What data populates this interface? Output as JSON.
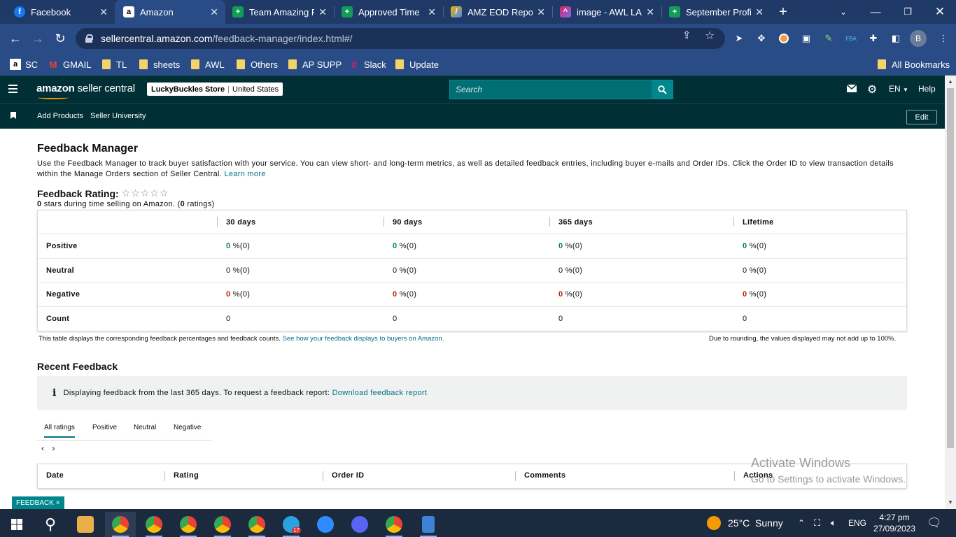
{
  "browser": {
    "tabs": [
      {
        "title": "Facebook",
        "icon": "facebook-icon",
        "color": "#1877f2",
        "glyph": "f"
      },
      {
        "title": "Amazon",
        "icon": "amazon-icon",
        "color": "#000000",
        "glyph": "a"
      },
      {
        "title": "Team Amazing P",
        "icon": "sheets-icon",
        "color": "#0f9d58",
        "glyph": "+"
      },
      {
        "title": "Approved Time",
        "icon": "sheets-icon",
        "color": "#0f9d58",
        "glyph": "+"
      },
      {
        "title": "AMZ EOD Repor",
        "icon": "slides-icon",
        "color": "#f4b400",
        "glyph": "/"
      },
      {
        "title": "image - AWL LA",
        "icon": "clickup-icon",
        "color": "#e0245e",
        "glyph": "^"
      },
      {
        "title": "September Profi",
        "icon": "sheets-icon",
        "color": "#0f9d58",
        "glyph": "+"
      }
    ],
    "url_domain": "sellercentral.amazon.com",
    "url_path": "/feedback-manager/index.html#/",
    "profile_initial": "B",
    "bookmarks": [
      {
        "label": "SC",
        "icon": "amazon-icon"
      },
      {
        "label": "GMAIL",
        "icon": "gmail-icon"
      },
      {
        "label": "TL",
        "icon": "folder-icon"
      },
      {
        "label": "sheets",
        "icon": "folder-icon"
      },
      {
        "label": "AWL",
        "icon": "folder-icon"
      },
      {
        "label": "Others",
        "icon": "folder-icon"
      },
      {
        "label": "AP SUPP",
        "icon": "folder-icon"
      },
      {
        "label": "Slack",
        "icon": "slack-icon"
      },
      {
        "label": "Update",
        "icon": "folder-icon"
      }
    ],
    "all_bookmarks": "All Bookmarks"
  },
  "header": {
    "logo_brand": "amazon",
    "logo_product": "seller central",
    "store_name": "LuckyBuckles Store",
    "marketplace": "United States",
    "search_placeholder": "Search",
    "language": "EN",
    "help": "Help"
  },
  "subnav": {
    "links": [
      "Add Products",
      "Seller University"
    ],
    "edit": "Edit"
  },
  "page": {
    "title": "Feedback Manager",
    "intro": "Use the Feedback Manager to track buyer satisfaction with your service. You can view short- and long-term metrics, as well as detailed feedback entries, including buyer e-mails and Order IDs. Click the Order ID to view transaction details within the Manage Orders section of Seller Central.",
    "learn_more": "Learn more",
    "rating_label": "Feedback Rating:",
    "stars": "☆☆☆☆☆",
    "rating_value": "0",
    "rating_text": "stars during time selling on Amazon. (",
    "rating_count": "0",
    "rating_count_suffix": "ratings)",
    "metrics": {
      "columns": [
        "30 days",
        "90 days",
        "365 days",
        "Lifetime"
      ],
      "rows": [
        {
          "label": "Positive",
          "values": [
            "0",
            "0",
            "0",
            "0"
          ],
          "suffix": "%(0)",
          "kind": "pos"
        },
        {
          "label": "Neutral",
          "values": [
            "0",
            "0",
            "0",
            "0"
          ],
          "suffix": "%(0)",
          "kind": "neu"
        },
        {
          "label": "Negative",
          "values": [
            "0",
            "0",
            "0",
            "0"
          ],
          "suffix": "%(0)",
          "kind": "neg"
        },
        {
          "label": "Count",
          "values": [
            "0",
            "0",
            "0",
            "0"
          ],
          "suffix": "",
          "kind": "count"
        }
      ]
    },
    "note_left": "This table displays the corresponding feedback percentages and feedback counts.",
    "note_left_link": "See how your feedback displays to buyers on Amazon.",
    "note_right": "Due to rounding, the values displayed may not add up to 100%.",
    "recent_title": "Recent Feedback",
    "info_text": "Displaying feedback from the last 365 days. To request a feedback report:",
    "info_link": "Download feedback report",
    "filter_tabs": [
      "All ratings",
      "Positive",
      "Neutral",
      "Negative"
    ],
    "pager_prev": "‹",
    "pager_next": "›",
    "feedback_columns": [
      "Date",
      "Rating",
      "Order ID",
      "Comments",
      "Actions"
    ],
    "feedback_badge": "FEEDBACK ×"
  },
  "watermark": {
    "line1": "Activate Windows",
    "line2": "Go to Settings to activate Windows."
  },
  "taskbar": {
    "weather": "25°C  Sunny",
    "lang": "ENG",
    "time": "4:27 pm",
    "date": "27/09/2023",
    "telegram_badge": "17"
  },
  "colors": {
    "brand_dark": "#002f36",
    "link": "#007185",
    "positive": "#067d62",
    "negative": "#b12704"
  }
}
